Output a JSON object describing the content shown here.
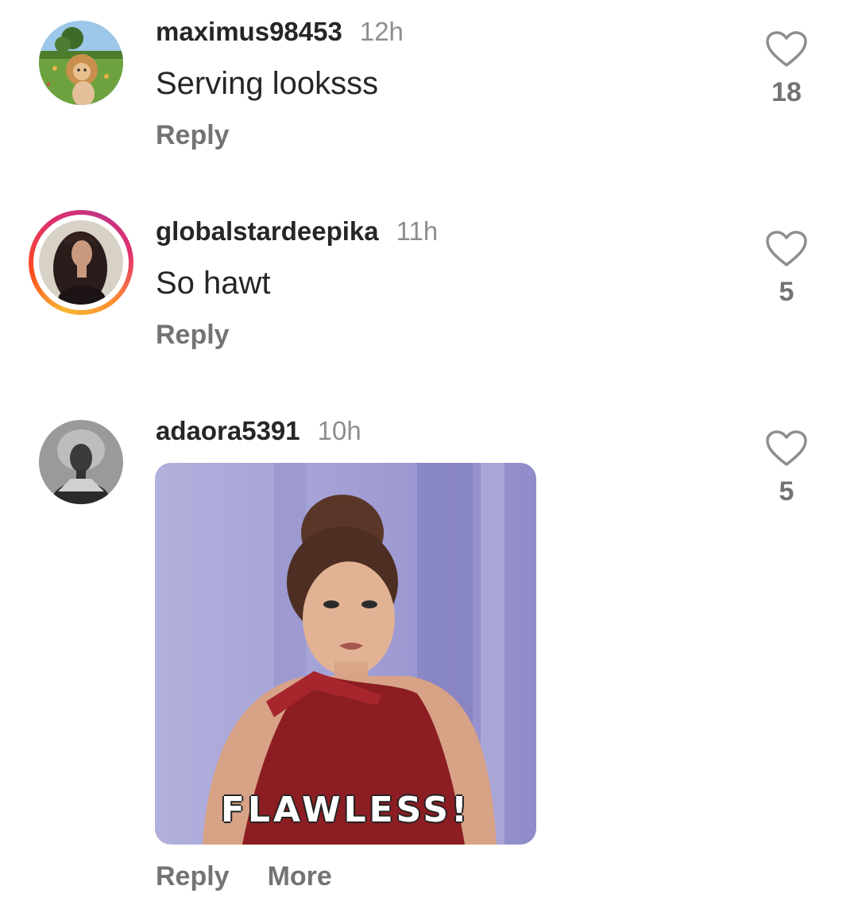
{
  "comments": [
    {
      "username": "maximus98453",
      "time": "12h",
      "text": "Serving looksss",
      "reply_label": "Reply",
      "likes": "18",
      "avatar_icon": "lion-cat-avatar",
      "has_story_ring": false
    },
    {
      "username": "globalstardeepika",
      "time": "11h",
      "text": "So hawt",
      "reply_label": "Reply",
      "likes": "5",
      "avatar_icon": "woman-portrait-avatar",
      "has_story_ring": true
    },
    {
      "username": "adaora5391",
      "time": "10h",
      "gif_caption": "FLAWLESS!",
      "reply_label": "Reply",
      "more_label": "More",
      "likes": "5",
      "avatar_icon": "woman-bw-portrait-avatar",
      "has_story_ring": false
    }
  ],
  "colors": {
    "text_primary": "#262626",
    "text_secondary": "#8e8e8e",
    "action_text": "#737373",
    "heart_outline": "#8e8e8e",
    "story_ring": [
      "#f7b733",
      "#fc4a1a",
      "#e1306c",
      "#c13584"
    ],
    "gif_background": "#a9a6d8"
  }
}
